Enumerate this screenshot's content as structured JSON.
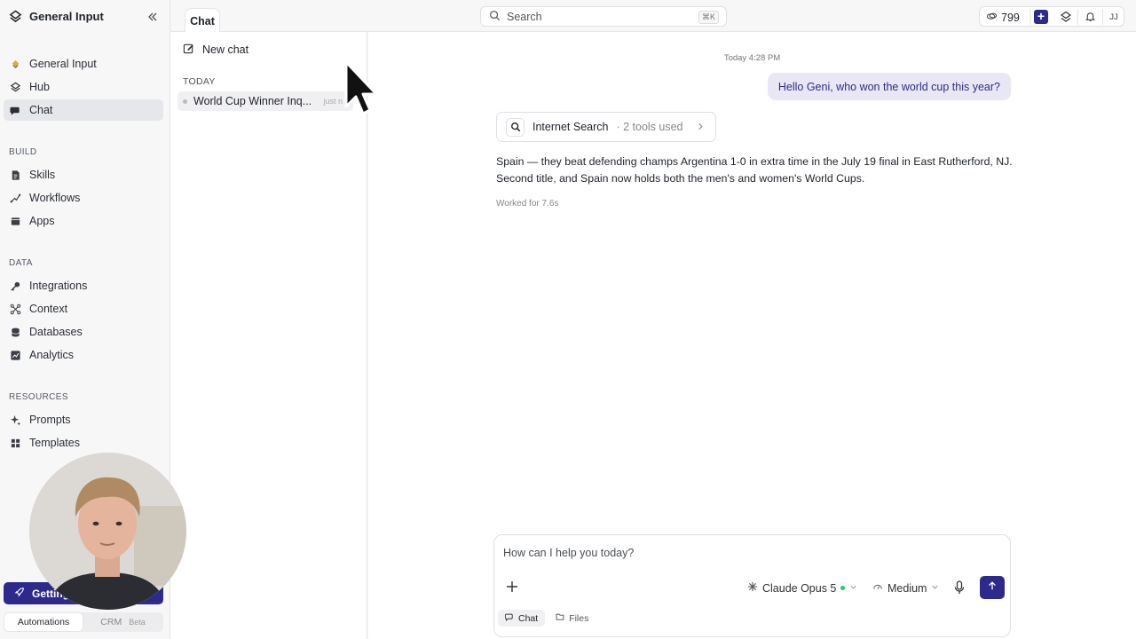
{
  "sidebar": {
    "brand": "General Input",
    "nav_top": [
      {
        "label": "General Input",
        "icon": "general-input-icon"
      },
      {
        "label": "Hub",
        "icon": "hub-icon"
      },
      {
        "label": "Chat",
        "icon": "chat-icon",
        "active": true
      }
    ],
    "sections": [
      {
        "title": "BUILD",
        "items": [
          {
            "label": "Skills",
            "icon": "document-icon"
          },
          {
            "label": "Workflows",
            "icon": "workflow-icon"
          },
          {
            "label": "Apps",
            "icon": "apps-icon"
          }
        ]
      },
      {
        "title": "DATA",
        "items": [
          {
            "label": "Integrations",
            "icon": "key-icon"
          },
          {
            "label": "Context",
            "icon": "network-icon"
          },
          {
            "label": "Databases",
            "icon": "database-icon"
          },
          {
            "label": "Analytics",
            "icon": "chart-icon"
          }
        ]
      },
      {
        "title": "RESOURCES",
        "items": [
          {
            "label": "Prompts",
            "icon": "sparkle-icon"
          },
          {
            "label": "Templates",
            "icon": "grid-icon"
          }
        ]
      }
    ],
    "getting_started": "Getting",
    "bottom_tabs": {
      "automations": "Automations",
      "crm": "CRM",
      "crm_badge": "Beta"
    }
  },
  "topbar": {
    "chat_tab": "Chat",
    "search_placeholder": "Search",
    "search_shortcut": "⌘K",
    "credits": "799",
    "avatar": "JJ",
    "accent": "#2e2a8c"
  },
  "chat_panel": {
    "new_chat": "New chat",
    "today_label": "TODAY",
    "items": [
      {
        "title": "World Cup Winner Inq...",
        "time": "just n"
      }
    ]
  },
  "conversation": {
    "timestamp": "Today 4:28 PM",
    "user_message": "Hello Geni, who won the world cup this year?",
    "tool_name": "Internet Search",
    "tool_meta": "· 2 tools used",
    "answer_line1": "Spain — they beat defending champs Argentina 1-0 in extra time in the July 19 final in East Rutherford, NJ.",
    "answer_line2": "Second title, and Spain now holds both the men's and women's World Cups.",
    "worked": "Worked for 7.6s"
  },
  "composer": {
    "placeholder": "How can I help you today?",
    "model": "Claude Opus 5",
    "effort": "Medium",
    "tabs": {
      "chat": "Chat",
      "files": "Files"
    }
  }
}
